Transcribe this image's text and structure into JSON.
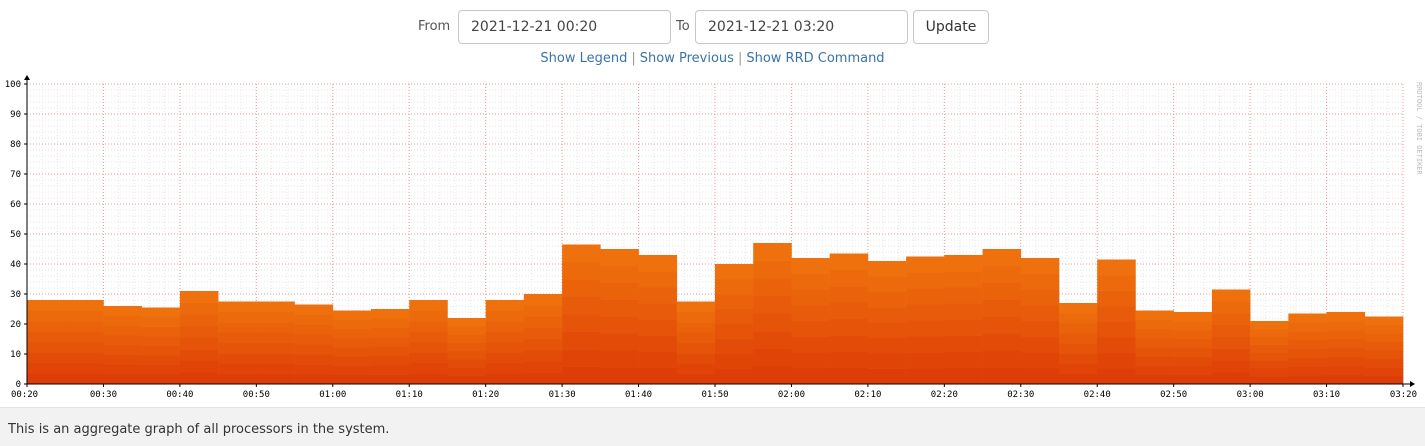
{
  "controls": {
    "from_label": "From",
    "from_value": "2021-12-21 00:20",
    "to_label": "To",
    "to_value": "2021-12-21 03:20",
    "update_label": "Update"
  },
  "links": {
    "show_legend": "Show Legend",
    "show_previous": "Show Previous",
    "show_rrd_command": "Show RRD Command",
    "separator": "|"
  },
  "watermark": "RRDTOOL / TOBI OETIKER",
  "footer": {
    "text": "This is an aggregate graph of all processors in the system."
  },
  "colors": {
    "stack": [
      "#dd3d06",
      "#e04507",
      "#e24c08",
      "#e55409",
      "#e75b0a",
      "#ea630b",
      "#ec6a0c",
      "#ee710d"
    ],
    "grid_major": "#ee9a9a",
    "grid_minor": "#e6e6e6",
    "footer_bg": "#f2f2f2",
    "link": "#3a73a6"
  },
  "chart_data": {
    "type": "area",
    "stacked": true,
    "step": true,
    "xlabel": "",
    "ylabel": "",
    "ylim": [
      0,
      100
    ],
    "yticks": [
      0,
      10,
      20,
      30,
      40,
      50,
      60,
      70,
      80,
      90,
      100
    ],
    "xlim": [
      "00:20",
      "03:20"
    ],
    "xticks": [
      "00:20",
      "00:30",
      "00:40",
      "00:50",
      "01:00",
      "01:10",
      "01:20",
      "01:30",
      "01:40",
      "01:50",
      "02:00",
      "02:10",
      "02:20",
      "02:30",
      "02:40",
      "02:50",
      "03:00",
      "03:10",
      "03:20"
    ],
    "grid": true,
    "x": [
      "00:20",
      "00:25",
      "00:30",
      "00:35",
      "00:40",
      "00:45",
      "00:50",
      "00:55",
      "01:00",
      "01:05",
      "01:10",
      "01:15",
      "01:20",
      "01:25",
      "01:30",
      "01:35",
      "01:40",
      "01:45",
      "01:50",
      "01:55",
      "02:00",
      "02:05",
      "02:10",
      "02:15",
      "02:20",
      "02:25",
      "02:30",
      "02:35",
      "02:40",
      "02:45",
      "02:50",
      "02:55",
      "03:00",
      "03:05",
      "03:10",
      "03:15"
    ],
    "totals": [
      28,
      28,
      26,
      25.5,
      31,
      27.5,
      27.5,
      26.5,
      24.5,
      25,
      28,
      22,
      28,
      30,
      46.5,
      45,
      43,
      27.5,
      40,
      47,
      42,
      43.5,
      41,
      42.5,
      43,
      45,
      42,
      27,
      41.5,
      24.5,
      24,
      31.5,
      21,
      23.5,
      24,
      22.5
    ]
  }
}
